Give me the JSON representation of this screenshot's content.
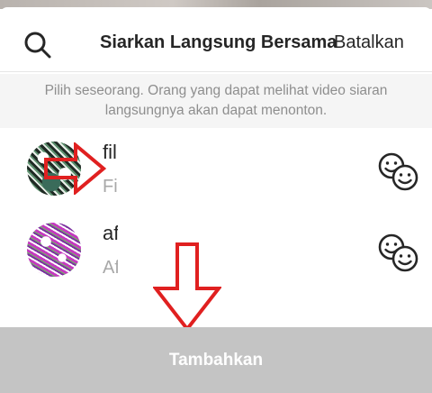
{
  "header": {
    "title": "Siarkan Langsung Bersama",
    "cancel_label": "Batalkan",
    "search_icon": "search-icon"
  },
  "notice": {
    "line1": "Pilih seseorang. Orang yang dapat melihat video siaran",
    "line2": "langsungnya akan dapat menonton."
  },
  "users": [
    {
      "username": "fil",
      "full_name": "Fi",
      "action_icon": "add-guest-icon"
    },
    {
      "username": "af",
      "full_name": "Af",
      "action_icon": "add-guest-icon"
    }
  ],
  "footer": {
    "button_label": "Tambahkan"
  },
  "colors": {
    "annotation_red": "#e02020",
    "button_disabled": "#c4c4c4",
    "notice_bg": "#f5f5f5",
    "secondary_text": "#a8a8a8"
  }
}
